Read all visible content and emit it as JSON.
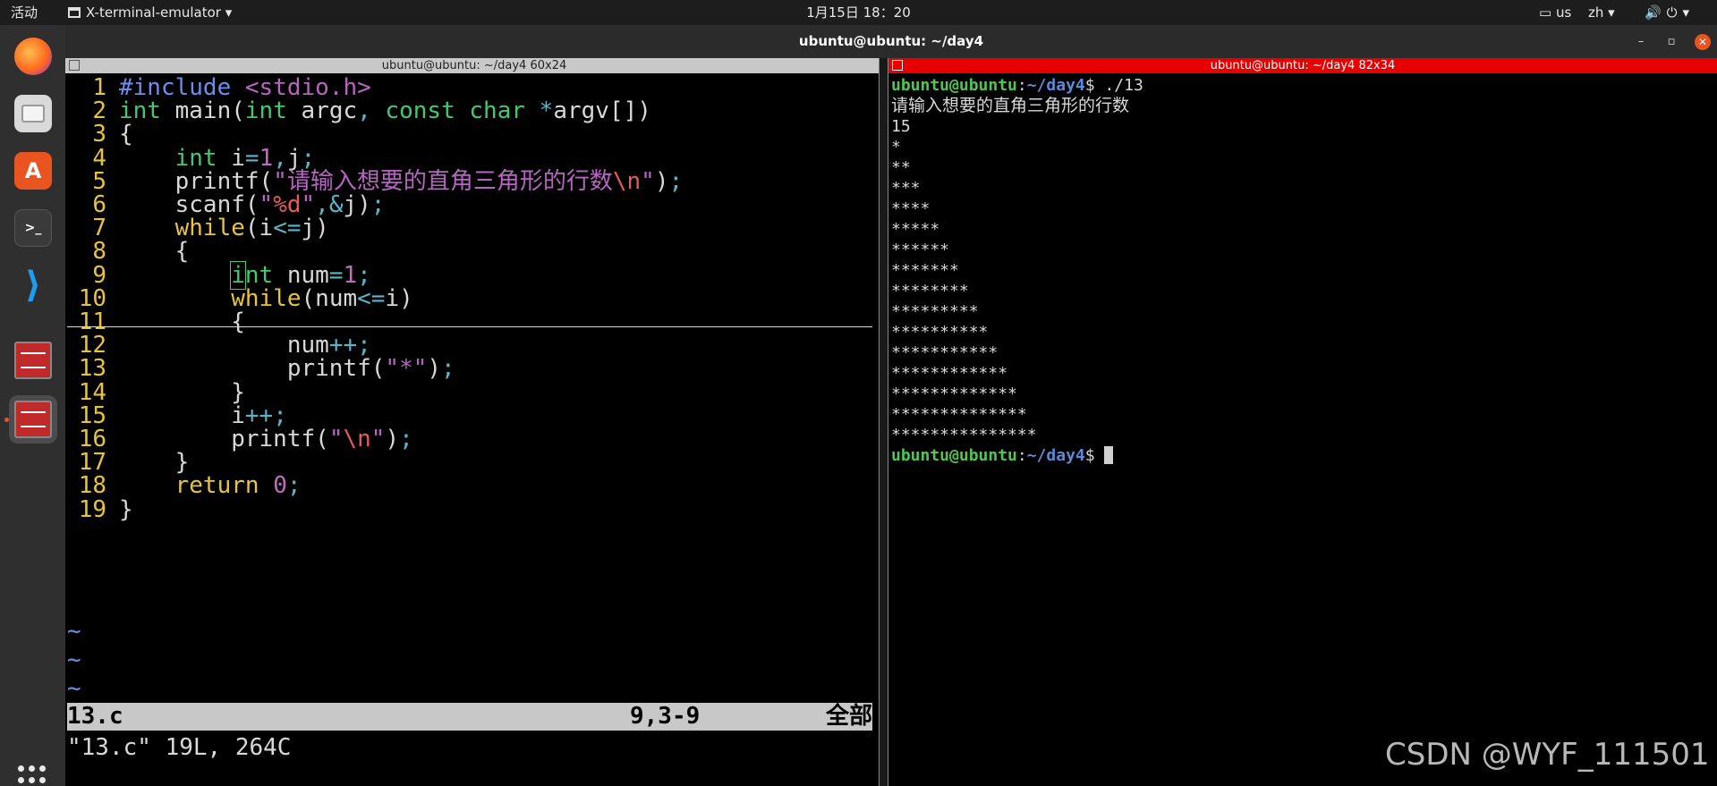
{
  "topbar": {
    "activities": "活动",
    "app_menu": "X-terminal-emulator",
    "clock": "1月15日 18：20",
    "keyboard": "us",
    "ime": "zh",
    "sys_icons": "🔊⏻▾"
  },
  "dock": {
    "items": [
      "firefox-icon",
      "files-icon",
      "software-icon",
      "terminal-icon",
      "vscode-icon",
      "terminator-icon",
      "terminator-icon"
    ]
  },
  "window": {
    "title": "ubuntu@ubuntu: ~/day4",
    "minimize": "–",
    "maximize": "▫",
    "close": "✕"
  },
  "left_pane": {
    "title": "ubuntu@ubuntu: ~/day4 60x24",
    "status_file": "13.c",
    "status_pos": "9,3-9",
    "status_pct": "全部",
    "cmdline": "\"13.c\" 19L, 264C",
    "tildes": [
      "~",
      "~",
      "~"
    ]
  },
  "right_pane": {
    "title": "ubuntu@ubuntu: ~/day4 82x34",
    "user": "ubuntu@ubuntu",
    "path": "~/day4",
    "prompt_sep": ":",
    "prompt_end": "$",
    "command": " ./13",
    "output": [
      "请输入想要的直角三角形的行数",
      "15",
      "*",
      "**",
      "***",
      "****",
      "*****",
      "******",
      "*******",
      "********",
      "*********",
      "**********",
      "***********",
      "************",
      "*************",
      "**************",
      "***************"
    ]
  },
  "code": [
    {
      "n": "1",
      "t": "#include <stdio.h>"
    },
    {
      "n": "2",
      "t": "int main(int argc, const char *argv[])"
    },
    {
      "n": "3",
      "t": "{"
    },
    {
      "n": "4",
      "t": "    int i=1,j;"
    },
    {
      "n": "5",
      "t": "    printf(\"请输入想要的直角三角形的行数\\n\");"
    },
    {
      "n": "6",
      "t": "    scanf(\"%d\",&j);"
    },
    {
      "n": "7",
      "t": "    while(i<=j)"
    },
    {
      "n": "8",
      "t": "    {"
    },
    {
      "n": "9",
      "t": "        int num=1;"
    },
    {
      "n": "10",
      "t": "        while(num<=i)"
    },
    {
      "n": "11",
      "t": "        {"
    },
    {
      "n": "12",
      "t": "            num++;"
    },
    {
      "n": "13",
      "t": "            printf(\"*\");"
    },
    {
      "n": "14",
      "t": "        }"
    },
    {
      "n": "15",
      "t": "        i++;"
    },
    {
      "n": "16",
      "t": "        printf(\"\\n\");"
    },
    {
      "n": "17",
      "t": "    }"
    },
    {
      "n": "18",
      "t": "    return 0;"
    },
    {
      "n": "19",
      "t": "}"
    }
  ],
  "watermark": "CSDN @WYF_111501",
  "colors": {
    "accent": "#e95420",
    "right_title_bg": "#e60000",
    "prompt_user": "#4ec84e",
    "prompt_path": "#5b8ad8"
  }
}
